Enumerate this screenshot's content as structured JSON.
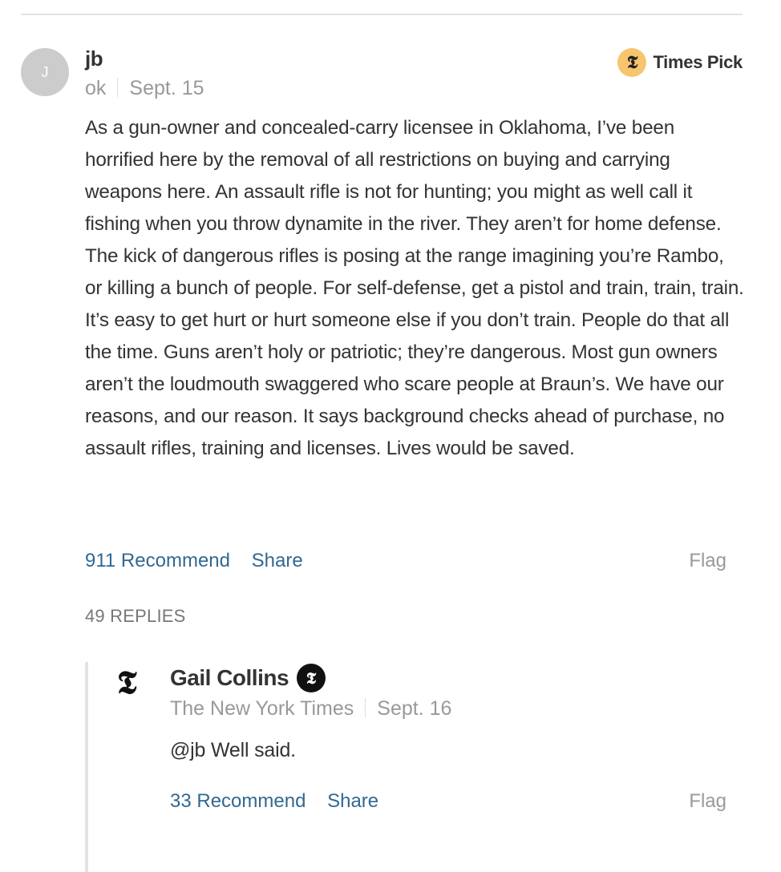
{
  "comment": {
    "avatar_initial": "J",
    "author": "jb",
    "location": "ok",
    "date": "Sept. 15",
    "times_pick_label": "Times Pick",
    "times_pick_icon": "nyt-t-icon",
    "body": "As a gun-owner and concealed-carry licensee in Oklahoma, I’ve been horrified here by the removal of all restrictions on buying and carrying weapons here. An assault rifle is not for hunting; you might as well call it fishing when you throw dynamite in the river. They aren’t for home defense. The kick of dangerous rifles is posing at the range imagining you’re Rambo, or killing a bunch of people. For self-defense, get a pistol and train, train, train. It’s easy to get hurt or hurt someone else if you don’t train. People do that all the time. Guns aren’t holy or patriotic; they’re dangerous. Most gun owners aren’t the loudmouth swaggered who scare people at Braun’s. We have our reasons, and our reason. It says background checks ahead of purchase, no assault rifles, training and licenses. Lives would be saved.",
    "recommend_label": "911 Recommend",
    "share_label": "Share",
    "flag_label": "Flag",
    "replies_label": "49 REPLIES"
  },
  "reply": {
    "logo_glyph": "𝕿",
    "author": "Gail Collins",
    "verified_icon": "nyt-verified-icon",
    "affiliation": "The New York Times",
    "date": "Sept. 16",
    "body": "@jb Well said.",
    "recommend_label": "33 Recommend",
    "share_label": "Share",
    "flag_label": "Flag"
  },
  "colors": {
    "link": "#326891",
    "muted": "#999999",
    "times_pick_badge": "#f6c56e",
    "text": "#333333"
  }
}
